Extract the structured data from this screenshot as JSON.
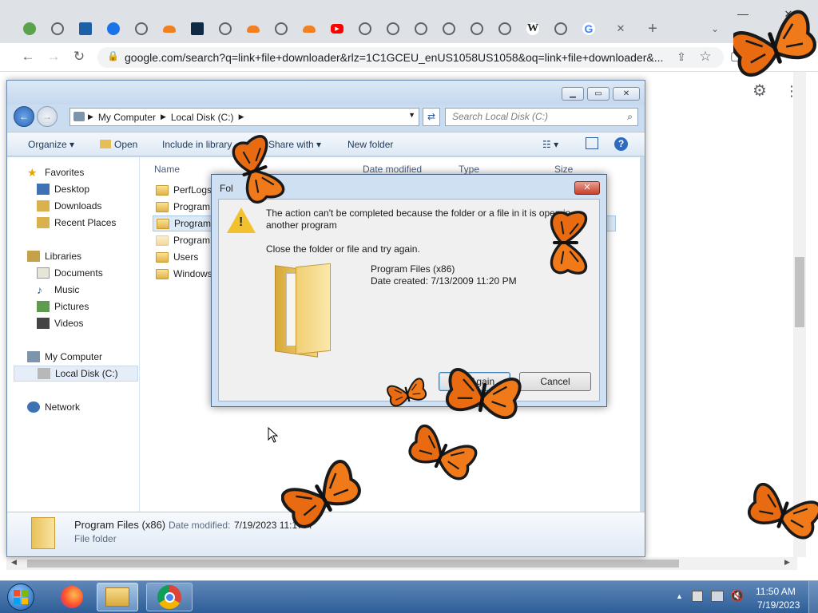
{
  "browser": {
    "tabs": [
      "avatar",
      "globe",
      "chart",
      "gear",
      "globe",
      "cloud",
      "circle",
      "globe",
      "cloud",
      "globe",
      "cloud",
      "youtube",
      "chrome",
      "chrome",
      "chrome",
      "chrome",
      "chrome",
      "chrome",
      "wiki",
      "globe",
      "google"
    ],
    "wiki_letter": "W",
    "google_letter": "G",
    "url": "google.com/search?q=link+file+downloader&rlz=1C1GCEU_enUS1058US1058&oq=link+file+downloader&...",
    "new_tab_label": "+",
    "close_tab_label": "✕"
  },
  "explorer": {
    "breadcrumb": [
      "My Computer",
      "Local Disk (C:)"
    ],
    "search_placeholder": "Search Local Disk (C:)",
    "commands": {
      "organize": "Organize",
      "open": "Open",
      "include": "Include in library",
      "share": "Share with",
      "new_folder": "New folder"
    },
    "nav": {
      "favorites": "Favorites",
      "desktop": "Desktop",
      "downloads": "Downloads",
      "recent": "Recent Places",
      "libraries": "Libraries",
      "documents": "Documents",
      "music": "Music",
      "pictures": "Pictures",
      "videos": "Videos",
      "computer": "My Computer",
      "local_disk": "Local Disk (C:)",
      "network": "Network"
    },
    "columns": {
      "name": "Name",
      "date": "Date modified",
      "type": "Type",
      "size": "Size"
    },
    "files": [
      "PerfLogs",
      "Program",
      "Program",
      "ProgramD",
      "Users",
      "Windows"
    ],
    "details": {
      "name": "Program Files (x86)",
      "date_label": "Date modified:",
      "date_value": "7/19/2023 11:17 A",
      "type": "File folder"
    }
  },
  "dialog": {
    "title": "Fol",
    "message1": "The action can't be completed because the folder or a file in it is open in",
    "message2": "another program",
    "message3": "Close the folder or file and try again.",
    "item_name": "Program Files (x86)",
    "item_date": "Date created: 7/13/2009 11:20 PM",
    "try_again": "Try Again",
    "cancel": "Cancel"
  },
  "taskbar": {
    "time": "11:50 AM",
    "date": "7/19/2023"
  }
}
